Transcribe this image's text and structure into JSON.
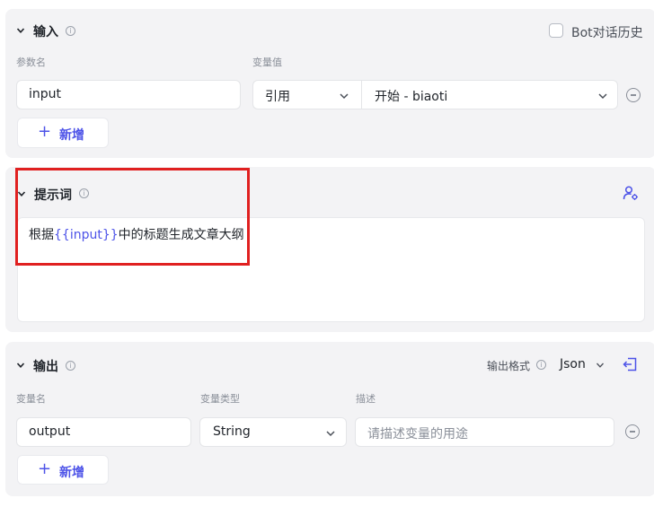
{
  "input": {
    "title": "输入",
    "bot_history_label": "Bot对话历史",
    "col_param": "参数名",
    "col_value": "变量值",
    "row": {
      "name": "input",
      "type": "引用",
      "ref": "开始 - biaoti"
    },
    "add_label": "新增"
  },
  "prompt": {
    "title": "提示词",
    "text_before": "根据",
    "var": "{{input}}",
    "text_after": "中的标题生成文章大纲"
  },
  "output": {
    "title": "输出",
    "format_label": "输出格式",
    "format_value": "Json",
    "col_name": "变量名",
    "col_type": "变量类型",
    "col_desc": "描述",
    "row": {
      "name": "output",
      "type": "String",
      "desc_placeholder": "请描述变量的用途"
    },
    "add_label": "新增"
  },
  "colors": {
    "accent": "#4d53e8",
    "highlight": "#e02020",
    "card_bg": "#f3f3f5"
  }
}
